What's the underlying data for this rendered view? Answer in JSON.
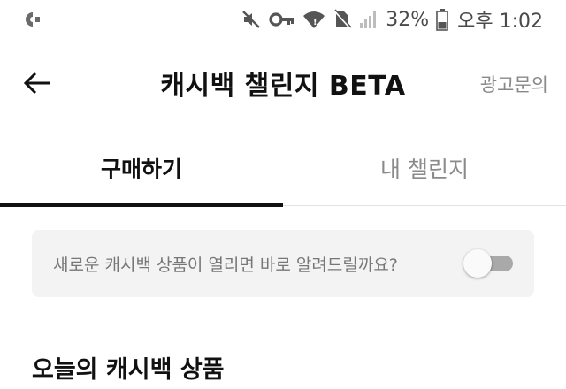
{
  "status_bar": {
    "left_icon": "app-notification-icon",
    "icons": [
      "mute-icon",
      "vpn-key-icon",
      "wifi-icon",
      "no-sim-icon",
      "signal-icon"
    ],
    "battery_percent": "32%",
    "battery_icon": "battery-icon",
    "time": "오후 1:02"
  },
  "app_bar": {
    "back_icon": "arrow-left-icon",
    "title": "캐시백 챌린지 BETA",
    "ad_link": "광고문의"
  },
  "tabs": [
    {
      "label": "구매하기",
      "active": true
    },
    {
      "label": "내 챌린지",
      "active": false
    }
  ],
  "notify": {
    "text": "새로운 캐시백 상품이 열리면 바로 알려드릴까요?",
    "toggle_on": false
  },
  "section": {
    "title": "오늘의 캐시백 상품"
  },
  "colors": {
    "text_primary": "#111111",
    "text_secondary": "#888888",
    "card_bg": "#f3f3f3",
    "toggle_track_off": "#a9a9a9",
    "tab_indicator": "#111111"
  }
}
